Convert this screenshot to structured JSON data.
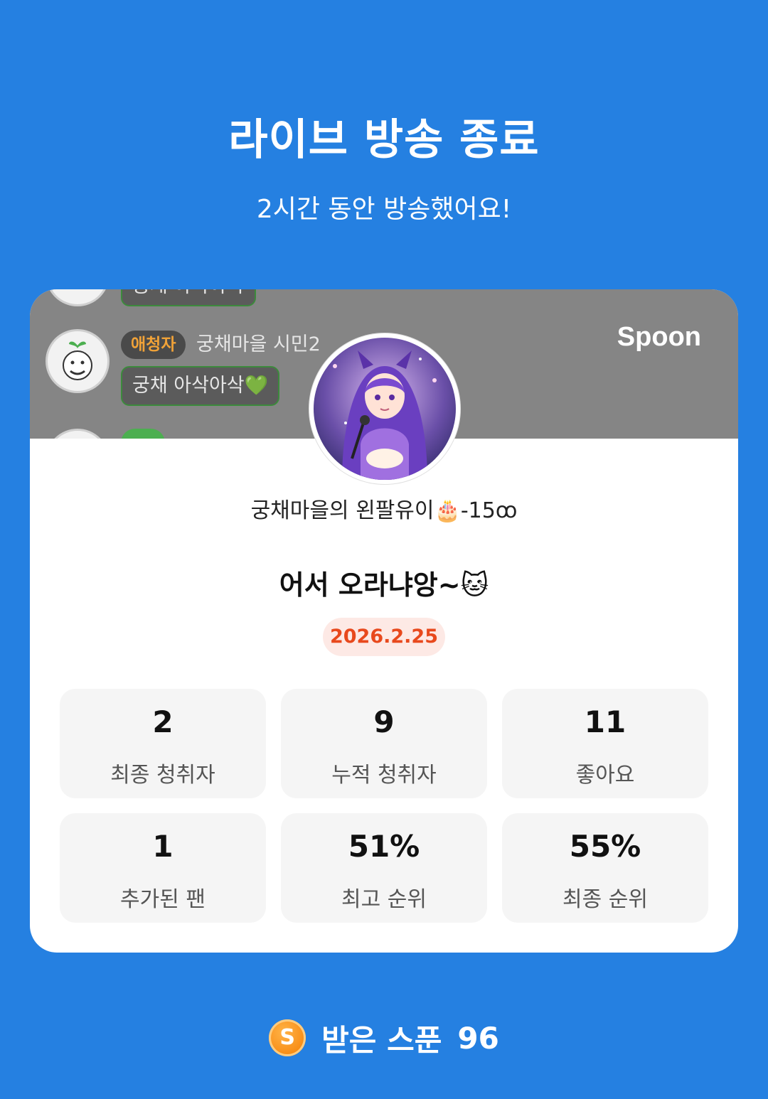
{
  "header": {
    "title": "라이브 방송 종료",
    "subtitle": "2시간 동안 방송했어요!"
  },
  "banner": {
    "brand": "Spoon",
    "chat_prev_text": "궁채 아삭아삭",
    "chat": {
      "badge": "애청자",
      "name": "궁채마을 시민2 ",
      "message": "궁채 아삭아삭💚"
    }
  },
  "profile": {
    "nickname": "궁채마을의 왼팔유이🎂-15ꝏ",
    "live_title": "어서 오라냐앙~🐱",
    "date": "2026.2.25"
  },
  "stats": [
    {
      "value": "2",
      "label": "최종 청취자"
    },
    {
      "value": "9",
      "label": "누적 청취자"
    },
    {
      "value": "11",
      "label": "좋아요"
    },
    {
      "value": "1",
      "label": "추가된 팬"
    },
    {
      "value": "51%",
      "label": "최고 순위"
    },
    {
      "value": "55%",
      "label": "최종 순위"
    }
  ],
  "footer": {
    "coin_letter": "S",
    "received_label": "받은 스푼",
    "received_value": "96"
  }
}
